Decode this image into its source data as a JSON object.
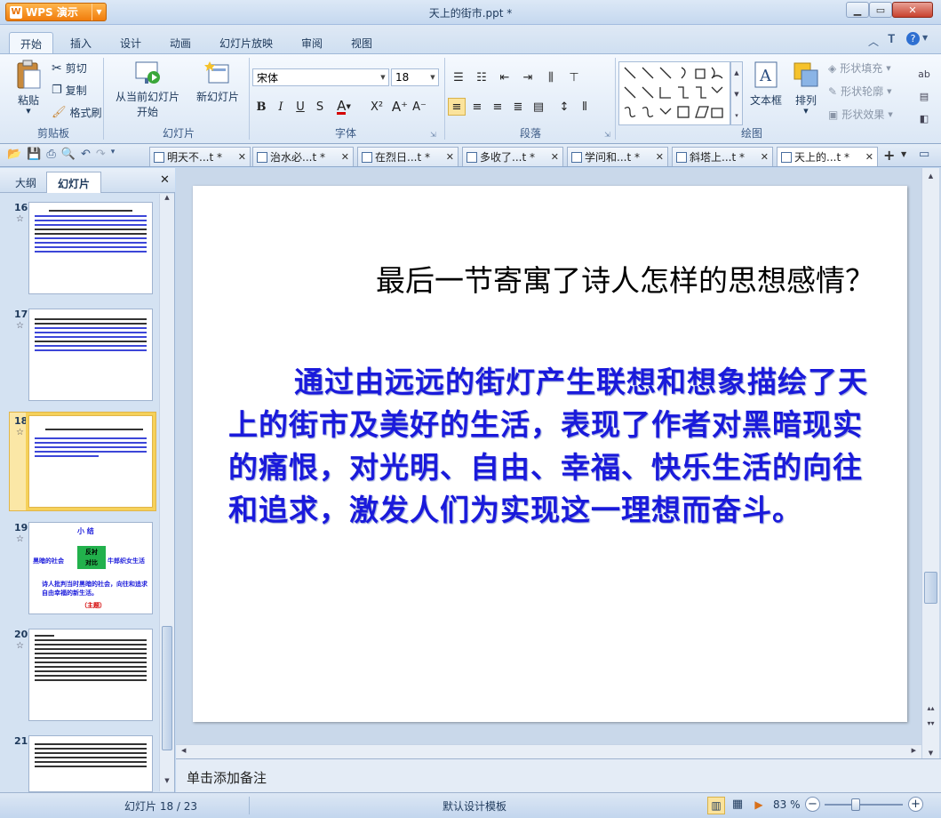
{
  "app": {
    "menu_button": "WPS 演示",
    "window_title": "天上的街市.ppt *"
  },
  "menu": {
    "tabs": [
      "开始",
      "插入",
      "设计",
      "动画",
      "幻灯片放映",
      "审阅",
      "视图"
    ]
  },
  "ribbon": {
    "clipboard": {
      "paste": "粘贴",
      "cut": "剪切",
      "copy": "复制",
      "format_painter": "格式刷",
      "label": "剪贴板"
    },
    "slides": {
      "from_current": "从当前幻灯片",
      "start": "开始",
      "new_slide": "新幻灯片",
      "label": "幻灯片"
    },
    "font": {
      "name": "宋体",
      "size": "18",
      "label": "字体",
      "bold": "B",
      "italic": "I",
      "underline": "U",
      "shadow": "S"
    },
    "paragraph": {
      "label": "段落"
    },
    "drawing": {
      "textbox": "文本框",
      "arrange": "排列",
      "shape_fill": "形状填充",
      "shape_outline": "形状轮廓",
      "shape_effect": "形状效果",
      "label": "绘图"
    }
  },
  "doc_tabs": [
    "明天不...t *",
    "治水必...t *",
    "在烈日...t *",
    "多收了...t *",
    "学问和...t *",
    "斜塔上...t *",
    "天上的...t *"
  ],
  "left_pane": {
    "tabs": [
      "大纲",
      "幻灯片"
    ],
    "thumbnails": [
      {
        "num": "16"
      },
      {
        "num": "17"
      },
      {
        "num": "18"
      },
      {
        "num": "19",
        "title": "小  结",
        "left": "黑暗的社会",
        "center1": "反衬",
        "center2": "对比",
        "right": "牛郎织女生活",
        "body": "诗人批判当时黑暗的社会，向往和追求自由幸福的新生活。",
        "tag": "（主题）"
      },
      {
        "num": "20"
      },
      {
        "num": "21"
      }
    ]
  },
  "slide": {
    "title": "最后一节寄寓了诗人怎样的思想感情？",
    "body": "通过由远远的街灯产生联想和想象描绘了天上的街市及美好的生活，表现了作者对黑暗现实的痛恨，对光明、自由、幸福、快乐生活的向往和追求，激发人们为实现这一理想而奋斗。"
  },
  "notes": {
    "placeholder": "单击添加备注"
  },
  "status": {
    "slide_counter": "幻灯片 18 / 23",
    "template": "默认设计模板",
    "zoom": "83 %"
  },
  "colors": {
    "accent": "#f07c0c",
    "body_text": "#1a1adb"
  }
}
